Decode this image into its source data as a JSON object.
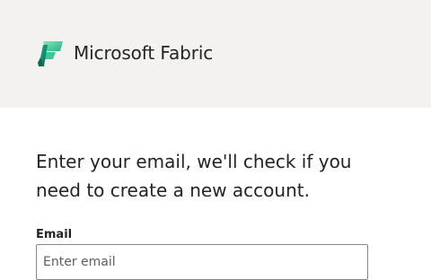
{
  "header": {
    "app_title": "Microsoft Fabric",
    "logo_icon": "fabric-logo-icon",
    "colors": {
      "background": "#f3f2f1",
      "logo_dark": "#0b6a53",
      "logo_mid": "#20b08e",
      "logo_light": "#8ae6b4"
    }
  },
  "main": {
    "heading": "Enter your email, we'll check if you need to create a new account.",
    "email": {
      "label": "Email",
      "placeholder": "Enter email",
      "value": ""
    }
  }
}
